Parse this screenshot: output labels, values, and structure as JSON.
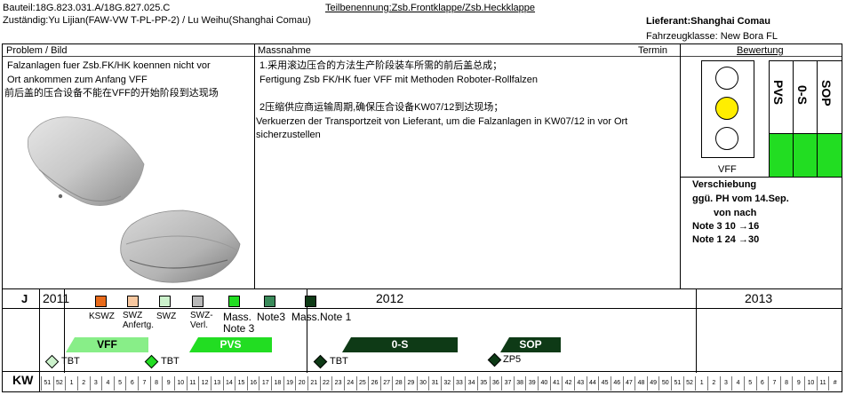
{
  "header": {
    "bauteil": "Bauteil:18G.823.031.A/18G.827.025.C",
    "teilbenennung": "Teilbenennung:Zsb.Frontklappe/Zsb.Heckklappe",
    "zustaendig": "Zuständig:Yu Lijian(FAW-VW T-PL-PP-2) / Lu Weihu(Shanghai Comau)",
    "lieferant": "Lieferant:Shanghai Comau",
    "fahrzeugklasse": "Fahrzeugklasse: New Bora FL"
  },
  "columns": {
    "problem": "Problem / Bild",
    "massnahme": "Massnahme",
    "termin": "Termin",
    "bewertung": "Bewertung"
  },
  "problem": {
    "line1": "Falzanlagen fuer Zsb.FK/HK koennen nicht vor",
    "line2": "Ort ankommen zum Anfang VFF",
    "line3": " 前后盖的压合设备不能在VFF的开始阶段到达现场"
  },
  "massnahme": {
    "p1_cn": "1.采用滚边压合的方法生产阶段装车所需的前后盖总成；",
    "p1_de": "Fertigung Zsb FK/HK fuer VFF mit Methoden Roboter-Rollfalzen",
    "p2_cn": "2压缩供应商运输周期,确保压合设备KW07/12到达现场；",
    "p2_de": " Verkuerzen der Transportzeit von Lieferant, um die Falzanlagen in KW07/12 in vor   Ort sicherzustellen"
  },
  "bewertung": {
    "phases": [
      "PVS",
      "0-S",
      "SOP"
    ],
    "vff_label": "VFF",
    "light_color": "#ffee00",
    "phase_color": "#22dd22",
    "verschiebung": [
      "Verschiebung",
      "ggü. PH vom 14.Sep.",
      "von nach",
      "Note 3 10 →16",
      "Note 1 24 →30"
    ]
  },
  "timeline": {
    "j_label": "J",
    "kw_label": "KW",
    "years": [
      "2011",
      "2012",
      "2013"
    ],
    "legend": [
      {
        "label": "KSWZ",
        "color": "#e86a1a"
      },
      {
        "label": "SWZ\nAnfertg.",
        "color": "#f8c8a0"
      },
      {
        "label": "SWZ",
        "color": "#ccf2cc"
      },
      {
        "label": "SWZ-\nVerl.",
        "color": "#b8b8b8"
      },
      {
        "label": "Mass.\nNote 3",
        "color": "#22dd22"
      },
      {
        "label": "Note3",
        "color": "#3a8a5a"
      },
      {
        "label": "Mass.Note 1",
        "color": "#0e3a16"
      }
    ],
    "bars": [
      {
        "label": "VFF",
        "color": "#88ee88"
      },
      {
        "label": "PVS",
        "color": "#22dd22"
      },
      {
        "label": "0-S",
        "color": "#0e3a16"
      },
      {
        "label": "SOP",
        "color": "#0e3a16"
      }
    ],
    "milestones": [
      "TBT",
      "TBT",
      "TBT",
      "ZP5"
    ],
    "weeks": [
      "51",
      "52",
      "1",
      "2",
      "3",
      "4",
      "5",
      "6",
      "7",
      "8",
      "9",
      "10",
      "11",
      "12",
      "13",
      "14",
      "15",
      "16",
      "17",
      "18",
      "19",
      "20",
      "21",
      "22",
      "23",
      "24",
      "25",
      "26",
      "27",
      "28",
      "29",
      "30",
      "31",
      "32",
      "33",
      "34",
      "35",
      "36",
      "37",
      "38",
      "39",
      "40",
      "41",
      "42",
      "43",
      "44",
      "45",
      "46",
      "47",
      "48",
      "49",
      "50",
      "51",
      "52",
      "1",
      "2",
      "3",
      "4",
      "5",
      "6",
      "7",
      "8",
      "9",
      "10",
      "11",
      "#"
    ]
  }
}
